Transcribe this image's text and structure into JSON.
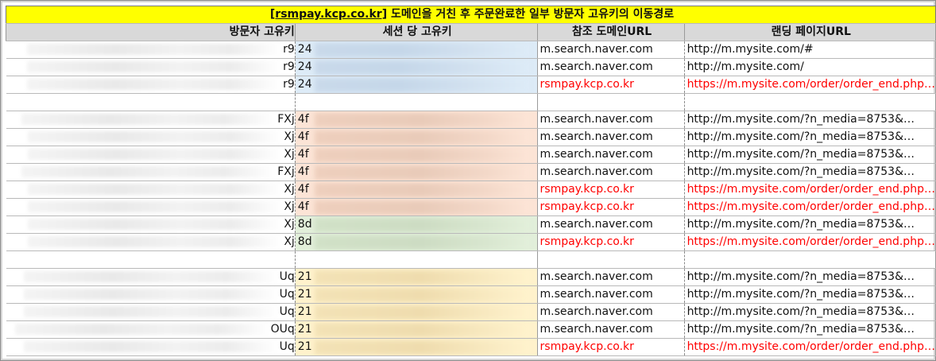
{
  "title": {
    "link": "[rsmpay.kcp.co.kr]",
    "text": " 도메인을 거친 후 주문완료한 일부 방문자 고유키의 이동경로"
  },
  "headers": [
    "방문자 고유키",
    "세션 당 고유키",
    "참조 도메인URL",
    "랜딩 페이지URL"
  ],
  "colors": {
    "title_bg": "#ffff00",
    "header_bg": "#d9d9d9",
    "group1_bg": "#ddebf7",
    "group2_bg": "#fce4d6",
    "group3_bg": "#e2efda",
    "group4_bg": "#fff2cc",
    "highlight_text": "#ff0000"
  },
  "rows": [
    {
      "visitor": "r9",
      "session": "24",
      "ref": "m.search.naver.com",
      "landing": "http://m.mysite.com/#",
      "group": "g1",
      "red": false
    },
    {
      "visitor": "r9",
      "session": "24",
      "ref": "m.search.naver.com",
      "landing": "http://m.mysite.com/",
      "group": "g1",
      "red": false
    },
    {
      "visitor": "r9",
      "session": "24",
      "ref": "rsmpay.kcp.co.kr",
      "landing": "https://m.mysite.com/order/order_end.php…",
      "group": "g1",
      "red": true
    },
    {
      "gap": true
    },
    {
      "visitor": "FXj",
      "session": "4f",
      "ref": "m.search.naver.com",
      "landing": "http://m.mysite.com/?n_media=8753&…",
      "group": "g2",
      "red": false
    },
    {
      "visitor": "Xj",
      "session": "4f",
      "ref": "m.search.naver.com",
      "landing": "http://m.mysite.com/?n_media=8753&…",
      "group": "g2",
      "red": false
    },
    {
      "visitor": "Xj",
      "session": "4f",
      "ref": "m.search.naver.com",
      "landing": "http://m.mysite.com/?n_media=8753&…",
      "group": "g2",
      "red": false
    },
    {
      "visitor": "FXj",
      "session": "4f",
      "ref": "m.search.naver.com",
      "landing": "http://m.mysite.com/?n_media=8753&…",
      "group": "g2",
      "red": false
    },
    {
      "visitor": "Xj",
      "session": "4f",
      "ref": "rsmpay.kcp.co.kr",
      "landing": "https://m.mysite.com/order/order_end.php…",
      "group": "g2",
      "red": true
    },
    {
      "visitor": "Xj",
      "session": "4f",
      "ref": "rsmpay.kcp.co.kr",
      "landing": "https://m.mysite.com/order/order_end.php…",
      "group": "g2",
      "red": true
    },
    {
      "visitor": "Xj",
      "session": "8d",
      "ref": "m.search.naver.com",
      "landing": "http://m.mysite.com/?n_media=8753&…",
      "group": "g3",
      "red": false
    },
    {
      "visitor": "Xj",
      "session": "8d",
      "ref": "rsmpay.kcp.co.kr",
      "landing": "https://m.mysite.com/order/order_end.php…",
      "group": "g3",
      "red": true
    },
    {
      "gap": true
    },
    {
      "visitor": "Uq",
      "session": "21",
      "ref": "m.search.naver.com",
      "landing": "http://m.mysite.com/?n_media=8753&…",
      "group": "g4",
      "red": false
    },
    {
      "visitor": "Uq",
      "session": "21",
      "ref": "m.search.naver.com",
      "landing": "http://m.mysite.com/?n_media=8753&…",
      "group": "g4",
      "red": false
    },
    {
      "visitor": "Uq",
      "session": "21",
      "ref": "m.search.naver.com",
      "landing": "http://m.mysite.com/?n_media=8753&…",
      "group": "g4",
      "red": false
    },
    {
      "visitor": "OUq",
      "session": "21",
      "ref": "m.search.naver.com",
      "landing": "http://m.mysite.com/?n_media=8753&…",
      "group": "g4",
      "red": false
    },
    {
      "visitor": "Uq",
      "session": "21",
      "ref": "rsmpay.kcp.co.kr",
      "landing": "https://m.mysite.com/order/order_end.php…",
      "group": "g4",
      "red": true
    }
  ]
}
